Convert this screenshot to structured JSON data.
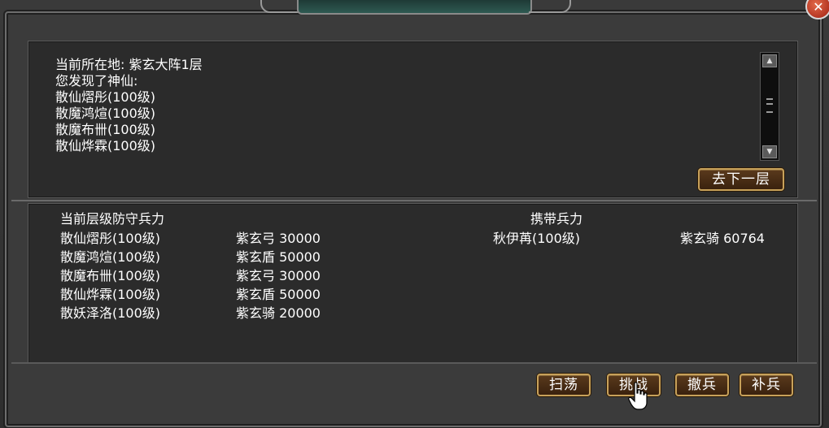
{
  "close_label": "✕",
  "location": "当前所在地: 紫玄大阵1层",
  "found_text": "您发现了神仙:",
  "found_list": [
    "散仙熠彤(100级)",
    "散魔鸿煊(100级)",
    "散魔布卌(100级)",
    "散仙烨霖(100级)"
  ],
  "next_floor_label": "去下一层",
  "defense": {
    "header": "当前层级防守兵力",
    "rows": [
      {
        "name": "散仙熠彤(100级)",
        "troop": "紫玄弓 30000"
      },
      {
        "name": "散魔鸿煊(100级)",
        "troop": "紫玄盾 50000"
      },
      {
        "name": "散魔布卌(100级)",
        "troop": "紫玄弓 30000"
      },
      {
        "name": "散仙烨霖(100级)",
        "troop": "紫玄盾 50000"
      },
      {
        "name": "散妖泽洛(100级)",
        "troop": "紫玄骑 20000"
      }
    ]
  },
  "carried": {
    "header": "携带兵力",
    "rows": [
      {
        "name": "秋伊苒(100级)",
        "troop": "紫玄骑 60764"
      }
    ]
  },
  "buttons": {
    "sweep": "扫荡",
    "challenge": "挑战",
    "withdraw": "撤兵",
    "replenish": "补兵"
  },
  "colors": {
    "button_border": "#c7a15a",
    "button_fill": "#4a2e14",
    "close_red": "#c0301a"
  },
  "icons": {
    "close": "close-icon",
    "scroll_up": "arrow-up-icon",
    "scroll_down": "arrow-down-icon",
    "cursor": "hand-pointer-icon"
  }
}
